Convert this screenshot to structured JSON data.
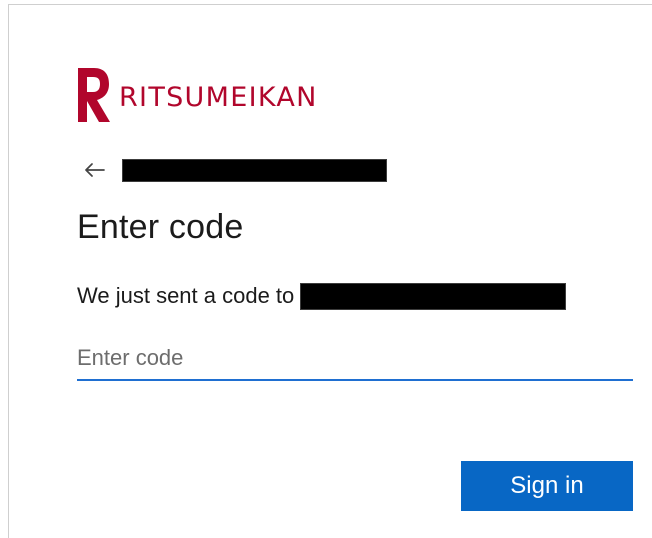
{
  "brand": {
    "name": "RITSUMEIKAN",
    "logo_icon": "ritsumeikan-r-logo",
    "color": "#b1062c"
  },
  "identity": {
    "back_icon": "arrow-left-icon",
    "redacted_value": ""
  },
  "form": {
    "title": "Enter code",
    "sent_text": "We just sent a code to",
    "redacted_destination": "",
    "code_placeholder": "Enter code",
    "code_value": "",
    "submit_label": "Sign in",
    "accent": "#0867c5",
    "input_focus_color": "#1f6fd1"
  }
}
